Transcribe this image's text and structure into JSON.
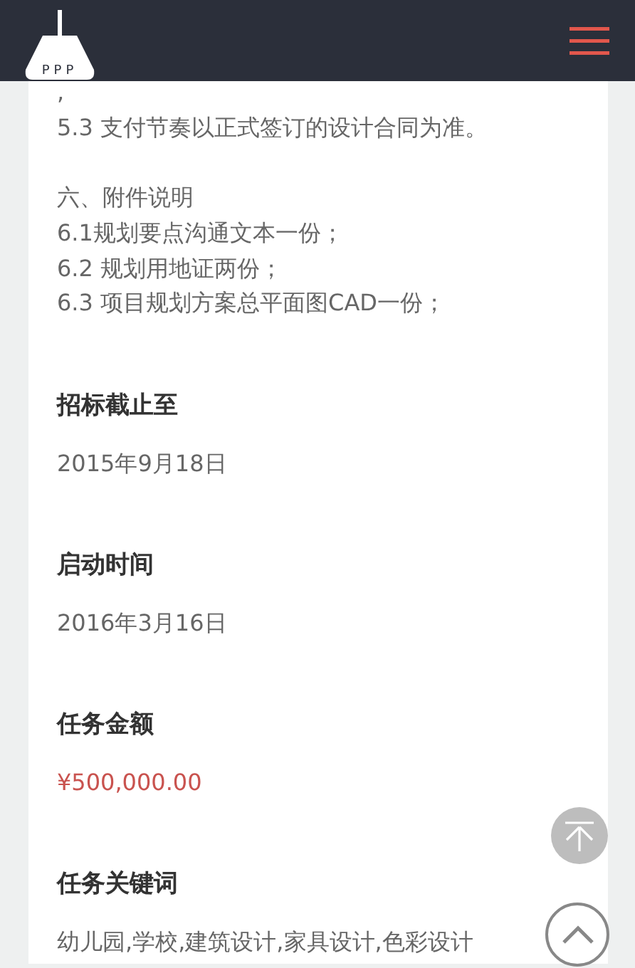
{
  "header": {
    "logo_text": "PPP"
  },
  "description": {
    "paragraphs": [
      [
        ",",
        "5.3 支付节奏以正式签订的设计合同为准。"
      ],
      [
        "六、附件说明",
        "6.1规划要点沟通文本一份；",
        "6.2 规划用地证两份；",
        "6.3 项目规划方案总平面图CAD一份；"
      ]
    ]
  },
  "fields": [
    {
      "kind": "plain",
      "label": "招标截止至",
      "value": "2015年9月18日"
    },
    {
      "kind": "plain",
      "label": "启动时间",
      "value": "2016年3月16日"
    },
    {
      "kind": "money",
      "label": "任务金额",
      "value": "¥500,000.00"
    },
    {
      "kind": "plain",
      "label": "任务关键词",
      "value": "幼儿园,学校,建筑设计,家具设计,色彩设计"
    }
  ]
}
